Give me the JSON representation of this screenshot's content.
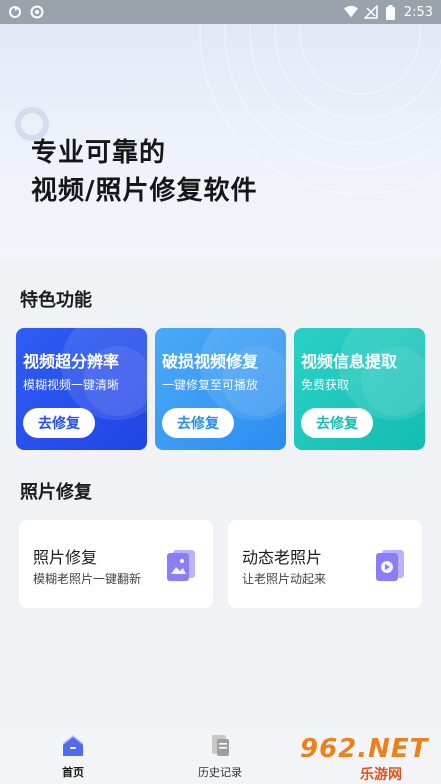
{
  "status_bar": {
    "time": "2:53",
    "icons": [
      "sync-icon",
      "target-icon",
      "wifi-icon",
      "signal-off-icon",
      "battery-icon"
    ]
  },
  "hero": {
    "title_line1": "专业可靠的",
    "title_line2": "视频/照片修复软件"
  },
  "features": {
    "section_title": "特色功能",
    "cards": [
      {
        "title": "视频超分辨率",
        "subtitle": "模糊视频一键清晰",
        "button": "去修复",
        "color": "#2a50ee"
      },
      {
        "title": "破损视频修复",
        "subtitle": "一键修复至可播放",
        "button": "去修复",
        "color": "#2b8ef0"
      },
      {
        "title": "视频信息提取",
        "subtitle": "免费获取",
        "button": "去修复",
        "color": "#16bdb2"
      }
    ]
  },
  "photo_repair": {
    "section_title": "照片修复",
    "cards": [
      {
        "title": "照片修复",
        "subtitle": "模糊老照片一键翻新",
        "icon": "photo-icon"
      },
      {
        "title": "动态老照片",
        "subtitle": "让老照片动起来",
        "icon": "video-photo-icon"
      }
    ]
  },
  "bottom_nav": {
    "items": [
      {
        "label": "首页",
        "icon": "home-icon",
        "active": true
      },
      {
        "label": "历史记录",
        "icon": "history-icon",
        "active": false
      }
    ]
  },
  "watermark": {
    "logo": "962.NET",
    "sub": "乐游网"
  }
}
